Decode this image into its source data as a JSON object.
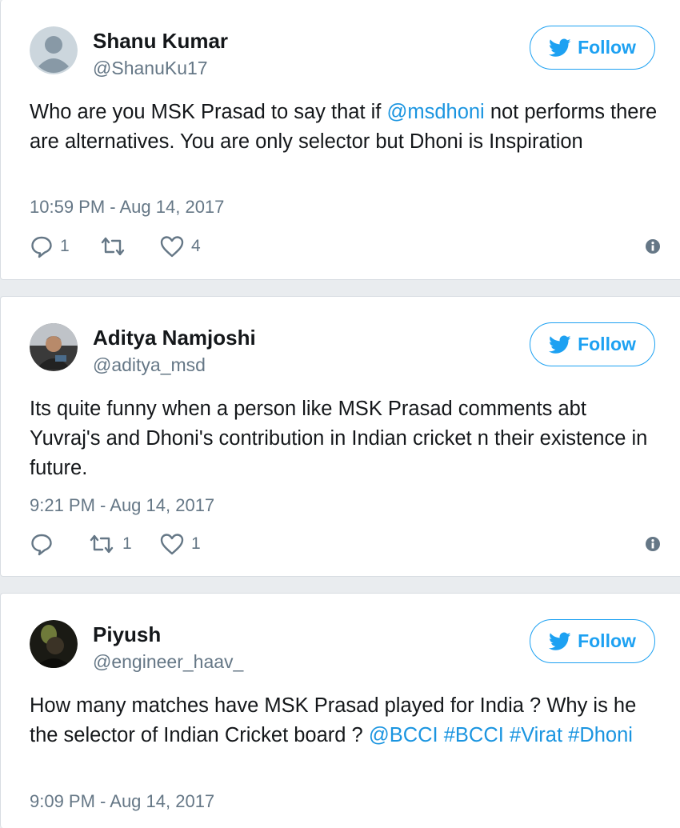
{
  "colors": {
    "accent": "#1da1f2",
    "link": "#1b95e0",
    "text": "#14171a",
    "muted": "#657786"
  },
  "tweets": [
    {
      "name": "Shanu Kumar",
      "handle": "@ShanuKu17",
      "follow_label": "Follow",
      "avatar": "default-avatar",
      "text": [
        "Who are you MSK Prasad to say that if ",
        "@msdhoni",
        " not performs there are alternatives. You are only selector but Dhoni is Inspiration"
      ],
      "time": "10:59 PM - Aug 14, 2017",
      "replies": "1",
      "retweets": "",
      "likes": "4"
    },
    {
      "name": "Aditya Namjoshi",
      "handle": "@aditya_msd",
      "follow_label": "Follow",
      "avatar": "photo-avatar",
      "text": [
        "Its quite funny when a person like MSK Prasad comments abt Yuvraj's and Dhoni's contribution in Indian cricket n their existence in future."
      ],
      "time": "9:21 PM - Aug 14, 2017",
      "replies": "",
      "retweets": "1",
      "likes": "1"
    },
    {
      "name": "Piyush",
      "handle": "@engineer_haav_",
      "follow_label": "Follow",
      "avatar": "photo-avatar",
      "text": [
        "How many matches have MSK Prasad played for India ? Why is he the selector of Indian Cricket board ? ",
        "@BCCI #BCCI #Virat #Dhoni"
      ],
      "time": "9:09 PM - Aug 14, 2017"
    }
  ]
}
